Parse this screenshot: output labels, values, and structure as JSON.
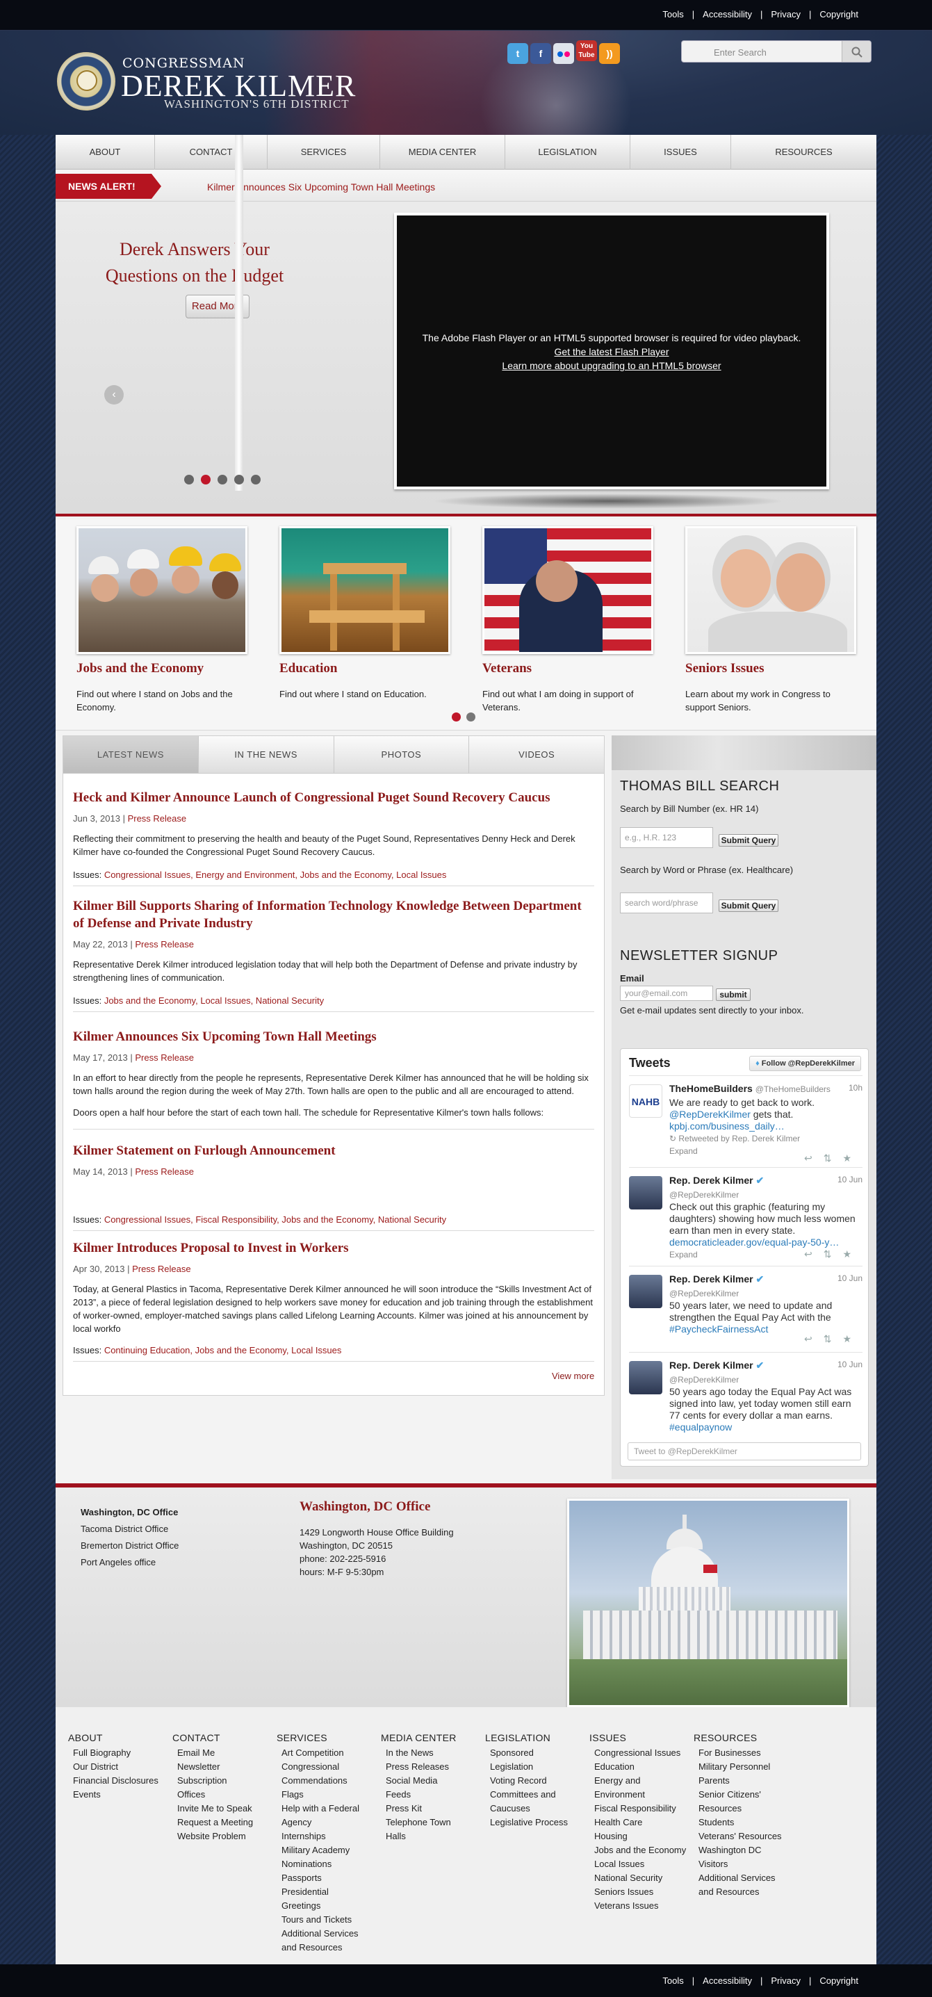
{
  "utility_links": [
    "Tools",
    "Accessibility",
    "Privacy",
    "Copyright"
  ],
  "header": {
    "congressman": "CONGRESSMAN",
    "name": "DEREK KILMER",
    "district": "WASHINGTON'S 6TH DISTRICT",
    "seal_text": "U.S. HOUSE OF REPRESENTATIVES",
    "search_placeholder": "Enter Search",
    "social": [
      "twitter-icon",
      "facebook-icon",
      "flickr-icon",
      "youtube-icon",
      "rss-icon"
    ]
  },
  "nav": [
    "ABOUT",
    "CONTACT",
    "SERVICES",
    "MEDIA CENTER",
    "LEGISLATION",
    "ISSUES",
    "RESOURCES"
  ],
  "alert": {
    "label": "NEWS ALERT!",
    "text": "Kilmer Announces Six Upcoming Town Hall Meetings"
  },
  "slider": {
    "title": "Derek Answers Your Questions on the Budget",
    "button": "Read More",
    "video_msg": "The Adobe Flash Player or an HTML5 supported browser is required for video playback.",
    "video_link1": "Get the latest Flash Player",
    "video_link2": "Learn more about upgrading to an HTML5 browser",
    "dots": 5,
    "active_dot": 1
  },
  "features": [
    {
      "title": "Jobs and the Economy",
      "text": "Find out where I stand on Jobs and the Economy."
    },
    {
      "title": "Education",
      "text": "Find out where I stand on Education."
    },
    {
      "title": "Veterans",
      "text": "Find out what I am doing in support of Veterans."
    },
    {
      "title": "Seniors Issues",
      "text": "Learn about my work in Congress to support Seniors."
    }
  ],
  "news_tabs": [
    "LATEST NEWS",
    "IN THE NEWS",
    "PHOTOS",
    "VIDEOS"
  ],
  "articles": [
    {
      "title": "Heck and Kilmer Announce Launch of Congressional Puget Sound Recovery Caucus",
      "date": "Jun 3, 2013",
      "type": "Press Release",
      "body": "Reflecting their commitment to preserving the health and beauty of the Puget Sound, Representatives Denny Heck and Derek Kilmer have co-founded the Congressional Puget Sound Recovery Caucus.",
      "issues_label": "Issues:",
      "issues": "Congressional Issues, Energy and Environment, Jobs and the Economy, Local Issues"
    },
    {
      "title": "Kilmer Bill Supports Sharing of Information Technology Knowledge Between Department of Defense and Private Industry",
      "date": "May 22, 2013",
      "type": "Press Release",
      "body": "Representative Derek Kilmer introduced legislation today that will help both the Department of Defense and private industry by strengthening lines of communication.",
      "issues_label": "Issues:",
      "issues": "Jobs and the Economy, Local Issues, National Security"
    },
    {
      "title": "Kilmer Announces Six Upcoming Town Hall Meetings",
      "date": "May 17, 2013",
      "type": "Press Release",
      "body": "In an effort to hear directly from the people he represents, Representative Derek Kilmer has announced that he will be holding six town halls around the region during the week of May 27th.  Town halls are open to the public and all are encouraged to attend.",
      "body2": "Doors open a half hour before the start of each town hall. The schedule for Representative Kilmer's town halls follows:"
    },
    {
      "title": "Kilmer Statement on Furlough Announcement",
      "date": "May 14, 2013",
      "type": "Press Release",
      "issues_label": "Issues:",
      "issues": "Congressional Issues, Fiscal Responsibility, Jobs and the Economy, National Security"
    },
    {
      "title": "Kilmer Introduces Proposal to Invest in Workers",
      "date": "Apr 30, 2013",
      "type": "Press Release",
      "body": "Today, at General Plastics in Tacoma, Representative Derek Kilmer announced he will soon introduce the “Skills Investment Act of 2013”, a piece of federal legislation designed to help workers save money for education and job training through the establishment of worker-owned, employer-matched savings plans called Lifelong Learning Accounts.  Kilmer was joined at his announcement by local workfo",
      "issues_label": "Issues:",
      "issues": "Continuing Education, Jobs and the Economy, Local Issues"
    }
  ],
  "view_more": "View more",
  "sidebar": {
    "bill_title": "THOMAS BILL SEARCH",
    "by_number": "Search by Bill Number (ex. HR 14)",
    "number_placeholder": "e.g., H.R. 123",
    "submit": "Submit Query",
    "by_word": "Search by Word or Phrase (ex. Healthcare)",
    "word_placeholder": "search word/phrase",
    "newsletter_title": "NEWSLETTER SIGNUP",
    "email_label": "Email",
    "email_placeholder": "your@email.com",
    "email_submit": "submit",
    "newsletter_text": "Get e-mail updates sent directly to your inbox."
  },
  "tweets": {
    "header": "Tweets",
    "follow": "Follow @RepDerekKilmer",
    "tweet_to": "Tweet to @RepDerekKilmer",
    "items": [
      {
        "name": "TheHomeBuilders",
        "handle": "@TheHomeBuilders",
        "time": "10h",
        "text": "We are ready to get back to work. ",
        "mention": "@RepDerekKilmer",
        "text2": " gets that. ",
        "link": "kpbj.com/business_daily…",
        "retweet": "Retweeted by Rep. Derek Kilmer",
        "expand": "Expand"
      },
      {
        "name": "Rep. Derek Kilmer",
        "handle": "@RepDerekKilmer",
        "time": "10 Jun",
        "text": "Check out this graphic (featuring my daughters) showing how much less women earn than men in every state. ",
        "link": "democraticleader.gov/equal-pay-50-y…",
        "expand": "Expand"
      },
      {
        "name": "Rep. Derek Kilmer",
        "handle": "@RepDerekKilmer",
        "time": "10 Jun",
        "text": "50 years later, we need to update and strengthen the Equal Pay Act with the ",
        "link": "#PaycheckFairnessAct"
      },
      {
        "name": "Rep. Derek Kilmer",
        "handle": "@RepDerekKilmer",
        "time": "10 Jun",
        "text": "50 years ago today the Equal Pay Act was signed into law, yet today women still earn 77 cents for every dollar a man earns. ",
        "link": "#equalpaynow"
      }
    ]
  },
  "offices": [
    "Washington, DC Office",
    "Tacoma District Office",
    "Bremerton District Office",
    "Port Angeles office"
  ],
  "office_detail": {
    "title": "Washington, DC Office",
    "address1": "1429 Longworth House Office Building",
    "address2": "Washington, DC 20515",
    "phone": "phone: 202-225-5916",
    "hours": "hours: M-F 9-5:30pm"
  },
  "sitemap": [
    {
      "heading": "About",
      "items": [
        "Full Biography",
        "Our District",
        "Financial Disclosures",
        "Events"
      ]
    },
    {
      "heading": "Contact",
      "items": [
        "Email Me",
        "Newsletter Subscription",
        "Offices",
        "Invite Me to Speak",
        "Request a Meeting",
        "Website Problem"
      ]
    },
    {
      "heading": "Services",
      "items": [
        "Art Competition",
        "Congressional Commendations",
        "Flags",
        "Help with a Federal Agency",
        "Internships",
        "Military Academy Nominations",
        "Passports",
        "Presidential Greetings",
        "Tours and Tickets",
        "Additional Services and Resources"
      ]
    },
    {
      "heading": "Media Center",
      "items": [
        "In the News",
        "Press Releases",
        "Social Media",
        "Feeds",
        "Press Kit",
        "Telephone Town Halls"
      ]
    },
    {
      "heading": "Legislation",
      "items": [
        "Sponsored Legislation",
        "Voting Record",
        "Committees and Caucuses",
        "Legislative Process"
      ]
    },
    {
      "heading": "Issues",
      "items": [
        "Congressional Issues",
        "Education",
        "Energy and Environment",
        "Fiscal Responsibility",
        "Health Care",
        "Housing",
        "Jobs and the Economy",
        "Local Issues",
        "National Security",
        "Seniors Issues",
        "Veterans Issues"
      ]
    },
    {
      "heading": "Resources",
      "items": [
        "For Businesses",
        "Military Personnel",
        "Parents",
        "Senior Citizens' Resources",
        "Students",
        "Veterans' Resources",
        "Washington DC Visitors",
        "Additional Services and Resources"
      ]
    }
  ],
  "colors": {
    "accent": "#9c1a1a",
    "nav_bg": "#e6e6e6",
    "alert": "#b51420"
  }
}
